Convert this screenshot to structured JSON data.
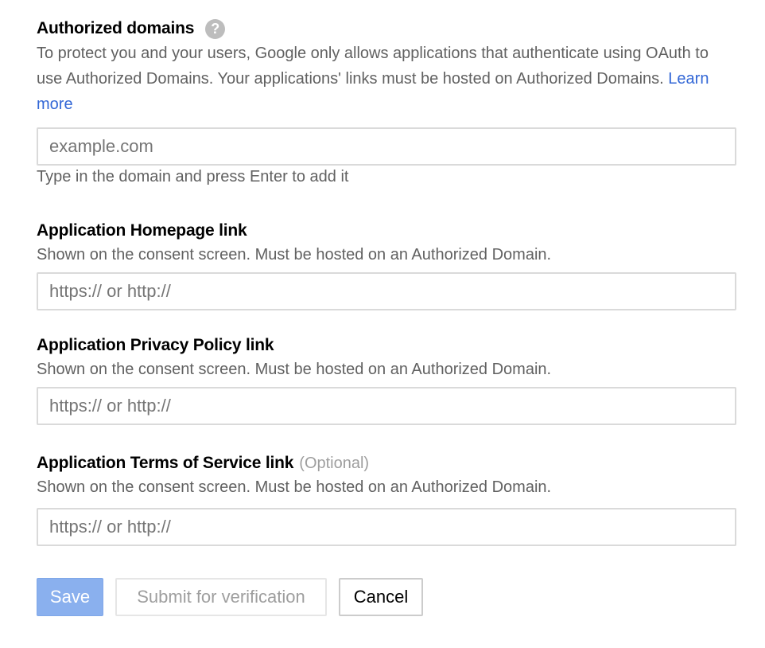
{
  "authorized_domains": {
    "label": "Authorized domains",
    "help_icon_glyph": "?",
    "description": "To protect you and your users, Google only allows applications that authenticate using OAuth to use Authorized Domains. Your applications' links must be hosted on Authorized Domains.",
    "learn_more": "Learn more",
    "input_placeholder": "example.com",
    "input_value": "",
    "hint": "Type in the domain and press Enter to add it"
  },
  "homepage": {
    "label": "Application Homepage link",
    "description": "Shown on the consent screen. Must be hosted on an Authorized Domain.",
    "input_placeholder": "https:// or http://",
    "input_value": ""
  },
  "privacy": {
    "label": "Application Privacy Policy link",
    "description": "Shown on the consent screen. Must be hosted on an Authorized Domain.",
    "input_placeholder": "https:// or http://",
    "input_value": ""
  },
  "terms": {
    "label": "Application Terms of Service link",
    "optional": "(Optional)",
    "description": "Shown on the consent screen. Must be hosted on an Authorized Domain.",
    "input_placeholder": "https:// or http://",
    "input_value": ""
  },
  "actions": {
    "save": "Save",
    "submit": "Submit for verification",
    "cancel": "Cancel"
  },
  "colors": {
    "link": "#3367d6",
    "save_bg": "#8ab0ee",
    "disabled_text": "#9e9e9e"
  }
}
